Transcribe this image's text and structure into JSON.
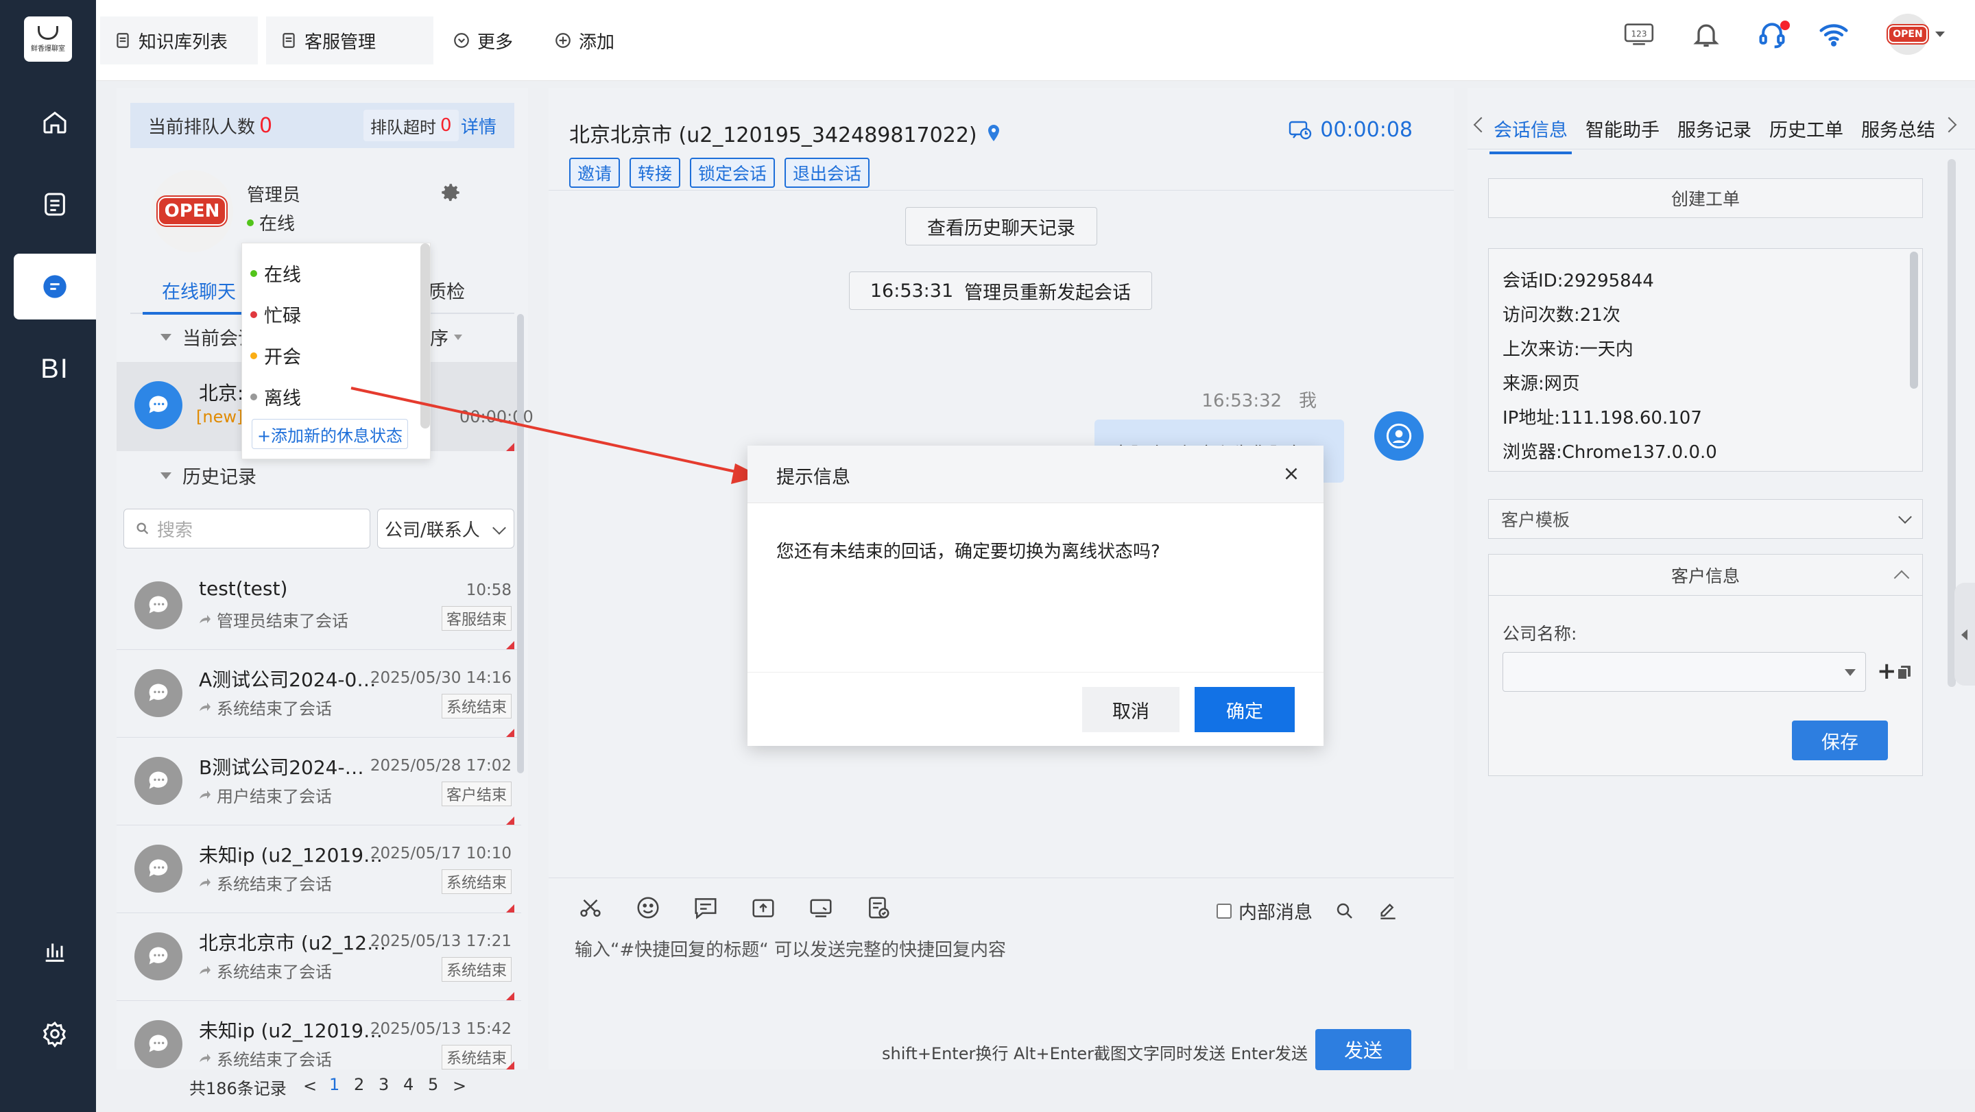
{
  "app": {
    "logo_text": "鲜香爆聊室",
    "colors": {
      "accent": "#1e6fd9",
      "sidebar": "#1e2a3b",
      "danger": "#f5222d",
      "online": "#52c41a",
      "busy": "#e0383e",
      "meeting": "#faad14",
      "offline": "#999999"
    }
  },
  "sidebar": {
    "items": [
      {
        "icon": "home-icon"
      },
      {
        "icon": "document-icon"
      },
      {
        "icon": "chat-icon",
        "active": true
      },
      {
        "label": "BI"
      },
      {
        "icon": "bar-chart-icon"
      },
      {
        "icon": "settings-icon"
      }
    ]
  },
  "topbar": {
    "tabs": [
      {
        "label": "知识库列表",
        "icon": "document-icon"
      },
      {
        "label": "客服管理",
        "icon": "document-icon"
      },
      {
        "label": "更多",
        "icon": "chevron-circle-icon"
      },
      {
        "label": "添加",
        "icon": "plus-circle-icon"
      }
    ],
    "keypad_badge": "123",
    "user_badge": "OPEN"
  },
  "left": {
    "queue_label": "当前排队人数",
    "queue_count": "0",
    "overtime_label": "排队超时",
    "overtime_count": "0",
    "detail_link": "详情",
    "agent_name": "管理员",
    "agent_status": "在线",
    "agent_badge": "OPEN",
    "tabs": [
      "在线聊天",
      "质检"
    ],
    "current_section": "当前会话",
    "current_section_short": "当前会话",
    "sort_label": "排序",
    "current_item": {
      "name": "北京:",
      "tag": "[new]",
      "time": "00:00:00"
    },
    "history_section": "历史记录",
    "search_placeholder": "搜索",
    "filter_select": "公司/联系人",
    "history": [
      {
        "name": "test(test)",
        "time": "10:58",
        "sub": "管理员结束了会话",
        "tag": "客服结束"
      },
      {
        "name": "A测试公司2024-0…",
        "time": "2025/05/30 14:16",
        "sub": "系统结束了会话",
        "tag": "系统结束"
      },
      {
        "name": "B测试公司2024-…",
        "time": "2025/05/28 17:02",
        "sub": "用户结束了会话",
        "tag": "客户结束"
      },
      {
        "name": "未知ip (u2_120195…",
        "time": "2025/05/17 10:10",
        "sub": "系统结束了会话",
        "tag": "系统结束"
      },
      {
        "name": "北京北京市 (u2_12…",
        "time": "2025/05/13 17:21",
        "sub": "系统结束了会话",
        "tag": "系统结束"
      },
      {
        "name": "未知ip (u2_12019…",
        "time": "2025/05/13 15:42",
        "sub": "系统结束了会话",
        "tag": "系统结束"
      }
    ],
    "pager": {
      "total": "共186条记录",
      "prev": "<",
      "pages": [
        "1",
        "2",
        "3",
        "4",
        "5"
      ],
      "next": ">",
      "current": "1"
    }
  },
  "status_menu": {
    "options": [
      {
        "label": "在线",
        "color": "#52c41a"
      },
      {
        "label": "忙碌",
        "color": "#e0383e"
      },
      {
        "label": "开会",
        "color": "#faad14"
      },
      {
        "label": "离线",
        "color": "#999999"
      }
    ],
    "add_label": "+添加新的休息状态"
  },
  "chat": {
    "title": "北京北京市 (u2_120195_342489817022)",
    "timer": "00:00:08",
    "actions": [
      "邀请",
      "转接",
      "锁定会话",
      "退出会话"
    ],
    "history_button": "查看历史聊天记录",
    "system_time": "16:53:31",
    "system_text": "管理员重新发起会话",
    "msg_time": "16:53:32",
    "msg_sender": "我",
    "msg_text": "客服小O很高兴为您服务!",
    "inner_message": "内部消息",
    "input_hint": "输入“#快捷回复的标题“ 可以发送完整的快捷回复内容",
    "shortcut_hint": "shift+Enter换行 Alt+Enter截图文字同时发送 Enter发送",
    "send": "发送"
  },
  "right": {
    "tabs": [
      "会话信息",
      "智能助手",
      "服务记录",
      "历史工单",
      "服务总结"
    ],
    "create_ticket": "创建工单",
    "info": [
      "会话ID:29295844",
      "访问次数:21次",
      "上次来访:一天内",
      "来源:网页",
      "IP地址:111.198.60.107",
      "浏览器:Chrome137.0.0.0"
    ],
    "template_select": "客户模板",
    "customer_info": "客户信息",
    "company_label": "公司名称:",
    "save": "保存"
  },
  "modal": {
    "title": "提示信息",
    "message": "您还有未结束的回话，确定要切换为离线状态吗?",
    "cancel": "取消",
    "confirm": "确定"
  }
}
